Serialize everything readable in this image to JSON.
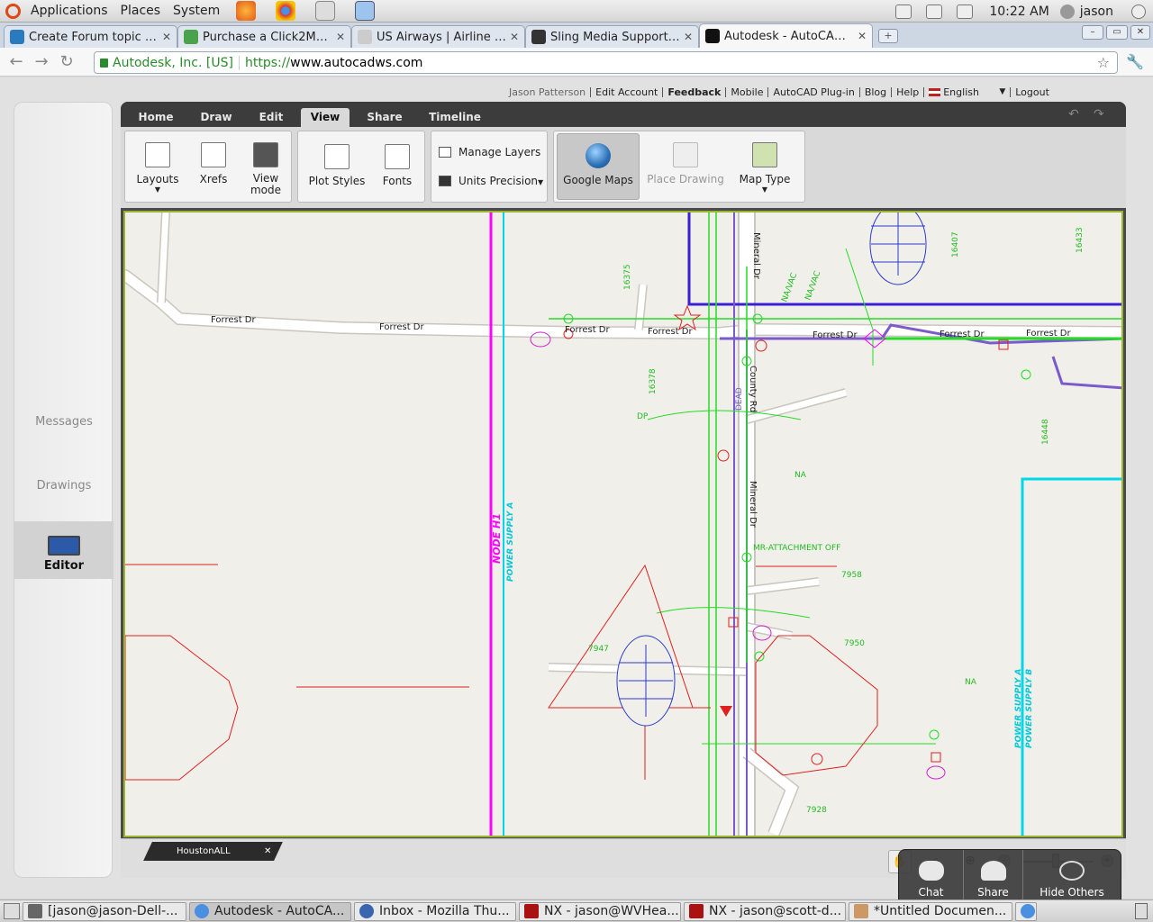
{
  "top_panel": {
    "menus": [
      "Applications",
      "Places",
      "System"
    ],
    "clock": "10:22 AM",
    "user": "jason"
  },
  "browser": {
    "tabs": [
      {
        "title": "Create Forum topic | ..."
      },
      {
        "title": "Purchase a Click2Map ..."
      },
      {
        "title": "US Airways | Airline tic..."
      },
      {
        "title": "Sling Media Support - ..."
      },
      {
        "title": "Autodesk - AutoCAD ..."
      }
    ],
    "ev_label": "Autodesk, Inc. [US]",
    "url_scheme": "https://",
    "url_rest": "www.autocadws.com"
  },
  "header_links": {
    "user_name": "Jason Patterson",
    "edit_account": "Edit Account",
    "feedback": "Feedback",
    "mobile": "Mobile",
    "plugin": "AutoCAD Plug-in",
    "blog": "Blog",
    "help": "Help",
    "language": "English",
    "logout": "Logout"
  },
  "side_nav": {
    "messages": "Messages",
    "drawings": "Drawings",
    "editor": "Editor"
  },
  "ribbon_tabs": [
    "Home",
    "Draw",
    "Edit",
    "View",
    "Share",
    "Timeline"
  ],
  "ribbon": {
    "layouts": "Layouts",
    "xrefs": "Xrefs",
    "view_mode": "View mode",
    "plot_styles": "Plot Styles",
    "fonts": "Fonts",
    "manage_layers": "Manage Layers",
    "units_precision": "Units Precision",
    "google_maps": "Google Maps",
    "place_drawing": "Place Drawing",
    "map_type": "Map Type"
  },
  "drawing": {
    "streets": [
      "Forrest Dr",
      "Forrest Dr",
      "Forrest Dr",
      "Forrest Dr",
      "Forrest Dr",
      "Forrest Dr",
      "Mineral Dr",
      "County Rd",
      "Mineral Dr"
    ],
    "annotations": [
      "NODE H1",
      "POWER SUPPLY A",
      "POWER SUPPLY A",
      "POWER SUPPLY B",
      "16375",
      "16378",
      "16407",
      "16433",
      "16448",
      "7947",
      "7950",
      "7958",
      "7928",
      "NA",
      "NA",
      "DP",
      "DEAD",
      "MR-ATTACHMENT OFF",
      "NA/VAC",
      "NA/VAC"
    ]
  },
  "status": {
    "drawing_tab": "HoustonALL"
  },
  "overlay": {
    "chat": "Chat",
    "share": "Share",
    "hide_others": "Hide Others"
  },
  "taskbar": [
    {
      "title": "[jason@jason-Dell-..."
    },
    {
      "title": "Autodesk - AutoCA..."
    },
    {
      "title": "Inbox - Mozilla Thu..."
    },
    {
      "title": "NX - jason@WVHea..."
    },
    {
      "title": "NX - jason@scott-d..."
    },
    {
      "title": "*Untitled Documen..."
    }
  ]
}
